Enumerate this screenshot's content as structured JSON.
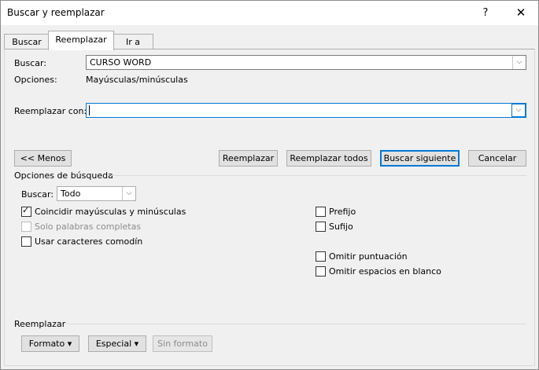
{
  "window": {
    "title": "Buscar y reemplazar",
    "help_glyph": "?",
    "close_glyph": "✕"
  },
  "tabs": [
    {
      "label": "Buscar",
      "active": false
    },
    {
      "label": "Reemplazar",
      "active": true
    },
    {
      "label": "Ir a",
      "active": false
    }
  ],
  "find": {
    "label": "Buscar:",
    "value": "CURSO WORD",
    "options_label": "Opciones:",
    "options_value": "Mayúsculas/minúsculas"
  },
  "replace": {
    "label": "Reemplazar con:",
    "value": ""
  },
  "buttons": {
    "less": "<< Menos",
    "replace": "Reemplazar",
    "replace_all": "Reemplazar todos",
    "find_next": "Buscar siguiente",
    "cancel": "Cancelar"
  },
  "search_options": {
    "group_label": "Opciones de búsqueda",
    "direction_label": "Buscar:",
    "direction_value": "Todo",
    "checkboxes_left": [
      {
        "label": "Coincidir mayúsculas y minúsculas",
        "checked": true,
        "enabled": true
      },
      {
        "label": "Solo palabras completas",
        "checked": false,
        "enabled": false
      },
      {
        "label": "Usar caracteres comodín",
        "checked": false,
        "enabled": true
      }
    ],
    "checkboxes_right": [
      {
        "label": "Prefijo",
        "checked": false
      },
      {
        "label": "Sufijo",
        "checked": false
      },
      {
        "label": "Omitir puntuación",
        "checked": false
      },
      {
        "label": "Omitir espacios en blanco",
        "checked": false
      }
    ]
  },
  "replace_section": {
    "group_label": "Reemplazar",
    "format": "Formato",
    "special": "Especial",
    "no_format": "Sin formato",
    "dropdown_glyph": "▾"
  },
  "glyphs": {
    "combo_arrow": "⌵",
    "check": "✓"
  }
}
